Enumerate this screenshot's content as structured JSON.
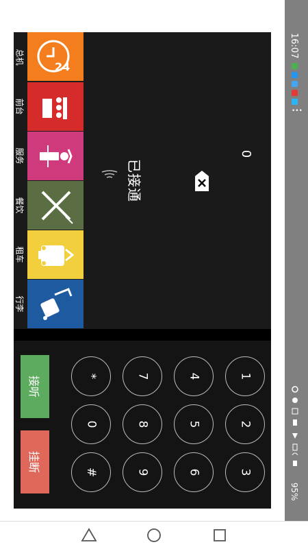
{
  "status_bar": {
    "time": "16:07",
    "battery": "95%"
  },
  "call": {
    "number": "0",
    "status": "已接通"
  },
  "categories": [
    {
      "label": "总机",
      "color": "#f47e1d",
      "icon": "clock-24-icon"
    },
    {
      "label": "前台",
      "color": "#d52b2b",
      "icon": "front-desk-icon"
    },
    {
      "label": "服务",
      "color": "#cf3a7d",
      "icon": "attendant-icon"
    },
    {
      "label": "餐饮",
      "color": "#5b6e43",
      "icon": "fork-knife-icon"
    },
    {
      "label": "租车",
      "color": "#f1cf3d",
      "icon": "taxi-icon"
    },
    {
      "label": "行李",
      "color": "#1e5aa0",
      "icon": "luggage-icon"
    }
  ],
  "keypad": {
    "keys": [
      "1",
      "2",
      "3",
      "4",
      "5",
      "6",
      "7",
      "8",
      "9",
      "*",
      "0",
      "#"
    ]
  },
  "actions": {
    "answer": "接听",
    "hangup": "挂断",
    "answer_color": "#5cab5e",
    "hangup_color": "#e0685a"
  }
}
